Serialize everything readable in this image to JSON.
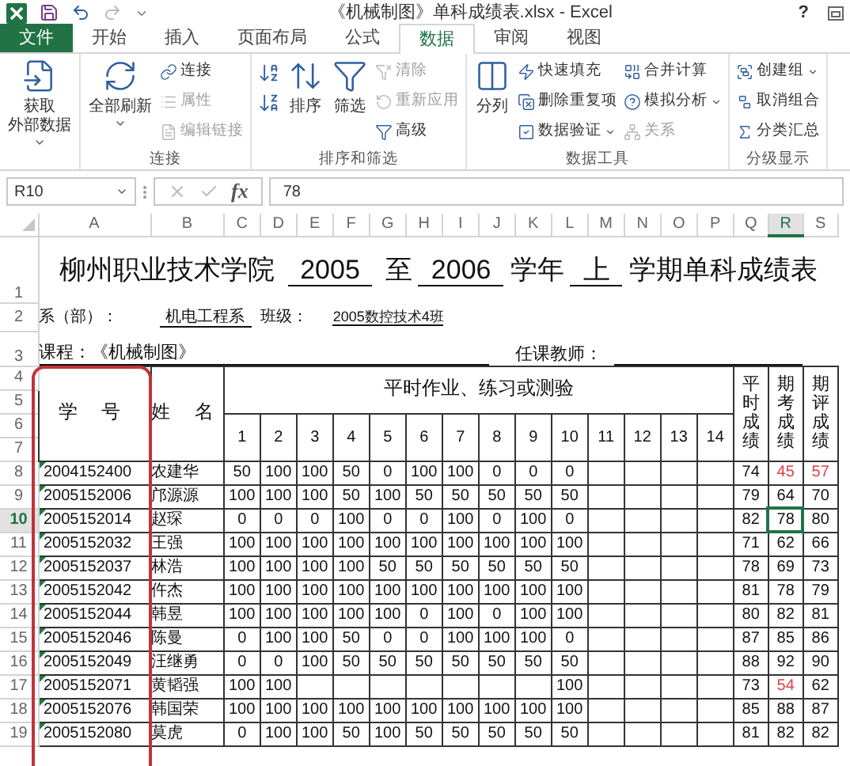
{
  "title_bar": {
    "title": "《机械制图》单科成绩表.xlsx - Excel",
    "help": "?"
  },
  "tabs": [
    {
      "label": "文件",
      "kind": "file",
      "selected": false
    },
    {
      "label": "开始",
      "kind": "tab",
      "selected": false
    },
    {
      "label": "插入",
      "kind": "tab",
      "selected": false
    },
    {
      "label": "页面布局",
      "kind": "tab",
      "selected": false
    },
    {
      "label": "公式",
      "kind": "tab",
      "selected": false
    },
    {
      "label": "数据",
      "kind": "tab",
      "selected": true
    },
    {
      "label": "审阅",
      "kind": "tab",
      "selected": false
    },
    {
      "label": "视图",
      "kind": "tab",
      "selected": false
    }
  ],
  "ribbon": [
    {
      "columns": [
        {
          "kind": "large",
          "items": [
            {
              "lines": [
                "获取",
                "外部数据"
              ],
              "dropdown": true,
              "disabled": false
            }
          ]
        }
      ]
    },
    {
      "label": "连接",
      "columns": [
        {
          "kind": "large",
          "items": [
            {
              "lines": [
                "全部刷新"
              ],
              "dropdown": true,
              "disabled": false
            }
          ]
        },
        {
          "kind": "stack",
          "items": [
            {
              "lines": [
                "连接"
              ],
              "dropdown": false,
              "disabled": false
            },
            {
              "lines": [
                "属性"
              ],
              "dropdown": false,
              "disabled": true
            },
            {
              "lines": [
                "编辑链接"
              ],
              "dropdown": false,
              "disabled": true
            }
          ]
        }
      ]
    },
    {
      "label": "排序和筛选",
      "columns": [
        {
          "kind": "stack",
          "items": [
            {
              "dropdown": false,
              "disabled": false
            },
            {
              "dropdown": false,
              "disabled": false
            }
          ]
        },
        {
          "kind": "large",
          "items": [
            {
              "lines": [
                "排序"
              ],
              "dropdown": false,
              "disabled": false
            }
          ]
        },
        {
          "kind": "large",
          "items": [
            {
              "lines": [
                "筛选"
              ],
              "dropdown": false,
              "disabled": false
            }
          ]
        },
        {
          "kind": "stack",
          "items": [
            {
              "lines": [
                "清除"
              ],
              "dropdown": false,
              "disabled": true
            },
            {
              "lines": [
                "重新应用"
              ],
              "dropdown": false,
              "disabled": true
            },
            {
              "lines": [
                "高级"
              ],
              "dropdown": false,
              "disabled": false
            }
          ]
        }
      ]
    },
    {
      "label": "数据工具",
      "columns": [
        {
          "kind": "large",
          "items": [
            {
              "lines": [
                "分列"
              ],
              "dropdown": false,
              "disabled": false
            }
          ]
        },
        {
          "kind": "stack",
          "items": [
            {
              "lines": [
                "快速填充"
              ],
              "dropdown": false,
              "disabled": false
            },
            {
              "lines": [
                "删除重复项"
              ],
              "dropdown": false,
              "disabled": false
            },
            {
              "lines": [
                "数据验证"
              ],
              "dropdown": true,
              "disabled": false
            }
          ]
        },
        {
          "kind": "stack",
          "items": [
            {
              "lines": [
                "合并计算"
              ],
              "dropdown": false,
              "disabled": false
            },
            {
              "lines": [
                "模拟分析"
              ],
              "dropdown": true,
              "disabled": false
            },
            {
              "lines": [
                "关系"
              ],
              "dropdown": false,
              "disabled": true
            }
          ]
        }
      ]
    },
    {
      "label": "分级显示",
      "columns": [
        {
          "kind": "stack",
          "items": [
            {
              "lines": [
                "创建组"
              ],
              "dropdown": true,
              "disabled": false
            },
            {
              "lines": [
                "取消组合"
              ],
              "dropdown": false,
              "disabled": false
            },
            {
              "lines": [
                "分类汇总"
              ],
              "dropdown": false,
              "disabled": false
            }
          ]
        }
      ]
    }
  ],
  "formula_bar": {
    "name_box": "R10",
    "fx": "fx",
    "value": "78"
  },
  "columns": [
    {
      "label": "A",
      "selected": false
    },
    {
      "label": "B",
      "selected": false
    },
    {
      "label": "C",
      "selected": false
    },
    {
      "label": "D",
      "selected": false
    },
    {
      "label": "E",
      "selected": false
    },
    {
      "label": "F",
      "selected": false
    },
    {
      "label": "G",
      "selected": false
    },
    {
      "label": "H",
      "selected": false
    },
    {
      "label": "I",
      "selected": false
    },
    {
      "label": "J",
      "selected": false
    },
    {
      "label": "K",
      "selected": false
    },
    {
      "label": "L",
      "selected": false
    },
    {
      "label": "M",
      "selected": false
    },
    {
      "label": "N",
      "selected": false
    },
    {
      "label": "O",
      "selected": false
    },
    {
      "label": "P",
      "selected": false
    },
    {
      "label": "Q",
      "selected": false
    },
    {
      "label": "R",
      "selected": true
    },
    {
      "label": "S",
      "selected": false
    }
  ],
  "header_rows": [
    "1",
    "2",
    "3",
    "4",
    "5",
    "6",
    "7"
  ],
  "title": {
    "school": "柳州职业技术学院",
    "year_from": "2005",
    "to": "至",
    "year_to": "2006",
    "year_label": "学年",
    "term": "上",
    "suffix": "学期单科成绩表"
  },
  "info": {
    "department_label": "系（部）：",
    "department": "机电工程系",
    "class_label": "班级：",
    "class": "2005数控技术4班",
    "course": "课程：《机械制图》",
    "teacher_label": "任课教师："
  },
  "headers": {
    "id": "学 号",
    "name": "姓 名",
    "assignments": "平时作业、练习或测验",
    "numbers": [
      "1",
      "2",
      "3",
      "4",
      "5",
      "6",
      "7",
      "8",
      "9",
      "10",
      "11",
      "12",
      "13",
      "14"
    ],
    "regular": "平时成绩",
    "exam": "期考成绩",
    "final": "期评成绩"
  },
  "students": [
    {
      "row": "8",
      "selected": false,
      "id": "2004152400",
      "name": "农建华",
      "scores": {
        "1": "50",
        "2": "100",
        "3": "100",
        "4": "50",
        "5": "0",
        "6": "100",
        "7": "100",
        "8": "0",
        "9": "0",
        "10": "0"
      },
      "regular": "74",
      "exam": {
        "value": "45",
        "low": true
      },
      "final": {
        "value": "57",
        "low": true
      }
    },
    {
      "row": "9",
      "selected": false,
      "id": "2005152006",
      "name": "邝源源",
      "scores": {
        "1": "100",
        "2": "100",
        "3": "100",
        "4": "50",
        "5": "100",
        "6": "50",
        "7": "50",
        "8": "50",
        "9": "50",
        "10": "50"
      },
      "regular": "79",
      "exam": {
        "value": "64",
        "low": false
      },
      "final": {
        "value": "70",
        "low": false
      }
    },
    {
      "row": "10",
      "selected": true,
      "id": "2005152014",
      "name": "赵琛",
      "scores": {
        "1": "0",
        "2": "0",
        "3": "0",
        "4": "100",
        "5": "0",
        "6": "0",
        "7": "100",
        "8": "0",
        "9": "100",
        "10": "0"
      },
      "regular": "82",
      "exam": {
        "value": "78",
        "low": false
      },
      "final": {
        "value": "80",
        "low": false
      }
    },
    {
      "row": "11",
      "selected": false,
      "id": "2005152032",
      "name": "王强",
      "scores": {
        "1": "100",
        "2": "100",
        "3": "100",
        "4": "100",
        "5": "100",
        "6": "100",
        "7": "100",
        "8": "100",
        "9": "100",
        "10": "100"
      },
      "regular": "71",
      "exam": {
        "value": "62",
        "low": false
      },
      "final": {
        "value": "66",
        "low": false
      }
    },
    {
      "row": "12",
      "selected": false,
      "id": "2005152037",
      "name": "林浩",
      "scores": {
        "1": "100",
        "2": "100",
        "3": "100",
        "4": "100",
        "5": "50",
        "6": "50",
        "7": "50",
        "8": "50",
        "9": "50",
        "10": "50"
      },
      "regular": "78",
      "exam": {
        "value": "69",
        "low": false
      },
      "final": {
        "value": "73",
        "low": false
      }
    },
    {
      "row": "13",
      "selected": false,
      "id": "2005152042",
      "name": "仵杰",
      "scores": {
        "1": "100",
        "2": "100",
        "3": "100",
        "4": "100",
        "5": "100",
        "6": "100",
        "7": "100",
        "8": "100",
        "9": "100",
        "10": "100"
      },
      "regular": "81",
      "exam": {
        "value": "78",
        "low": false
      },
      "final": {
        "value": "79",
        "low": false
      }
    },
    {
      "row": "14",
      "selected": false,
      "id": "2005152044",
      "name": "韩昱",
      "scores": {
        "1": "100",
        "2": "100",
        "3": "100",
        "4": "100",
        "5": "100",
        "6": "0",
        "7": "100",
        "8": "0",
        "9": "100",
        "10": "100"
      },
      "regular": "80",
      "exam": {
        "value": "82",
        "low": false
      },
      "final": {
        "value": "81",
        "low": false
      }
    },
    {
      "row": "15",
      "selected": false,
      "id": "2005152046",
      "name": "陈曼",
      "scores": {
        "1": "0",
        "2": "100",
        "3": "100",
        "4": "50",
        "5": "0",
        "6": "0",
        "7": "100",
        "8": "100",
        "9": "100",
        "10": "0"
      },
      "regular": "87",
      "exam": {
        "value": "85",
        "low": false
      },
      "final": {
        "value": "86",
        "low": false
      }
    },
    {
      "row": "16",
      "selected": false,
      "id": "2005152049",
      "name": "汪继勇",
      "scores": {
        "1": "0",
        "2": "0",
        "3": "100",
        "4": "50",
        "5": "50",
        "6": "50",
        "7": "50",
        "8": "50",
        "9": "50",
        "10": "50"
      },
      "regular": "88",
      "exam": {
        "value": "92",
        "low": false
      },
      "final": {
        "value": "90",
        "low": false
      }
    },
    {
      "row": "17",
      "selected": false,
      "id": "2005152071",
      "name": "黄韬强",
      "scores": {
        "1": "100",
        "2": "100",
        "10": "100"
      },
      "regular": "73",
      "exam": {
        "value": "54",
        "low": true
      },
      "final": {
        "value": "62",
        "low": false
      }
    },
    {
      "row": "18",
      "selected": false,
      "id": "2005152076",
      "name": "韩国荣",
      "scores": {
        "1": "100",
        "2": "100",
        "3": "100",
        "4": "100",
        "5": "100",
        "6": "100",
        "7": "100",
        "8": "100",
        "9": "100",
        "10": "100"
      },
      "regular": "85",
      "exam": {
        "value": "88",
        "low": false
      },
      "final": {
        "value": "87",
        "low": false
      }
    },
    {
      "row": "19",
      "selected": false,
      "id": "2005152080",
      "name": "莫虎",
      "scores": {
        "1": "0",
        "2": "100",
        "3": "100",
        "4": "50",
        "5": "100",
        "6": "50",
        "7": "50",
        "8": "50",
        "9": "50",
        "10": "50"
      },
      "regular": "81",
      "exam": {
        "value": "82",
        "low": false
      },
      "final": {
        "value": "82",
        "low": false
      }
    }
  ]
}
